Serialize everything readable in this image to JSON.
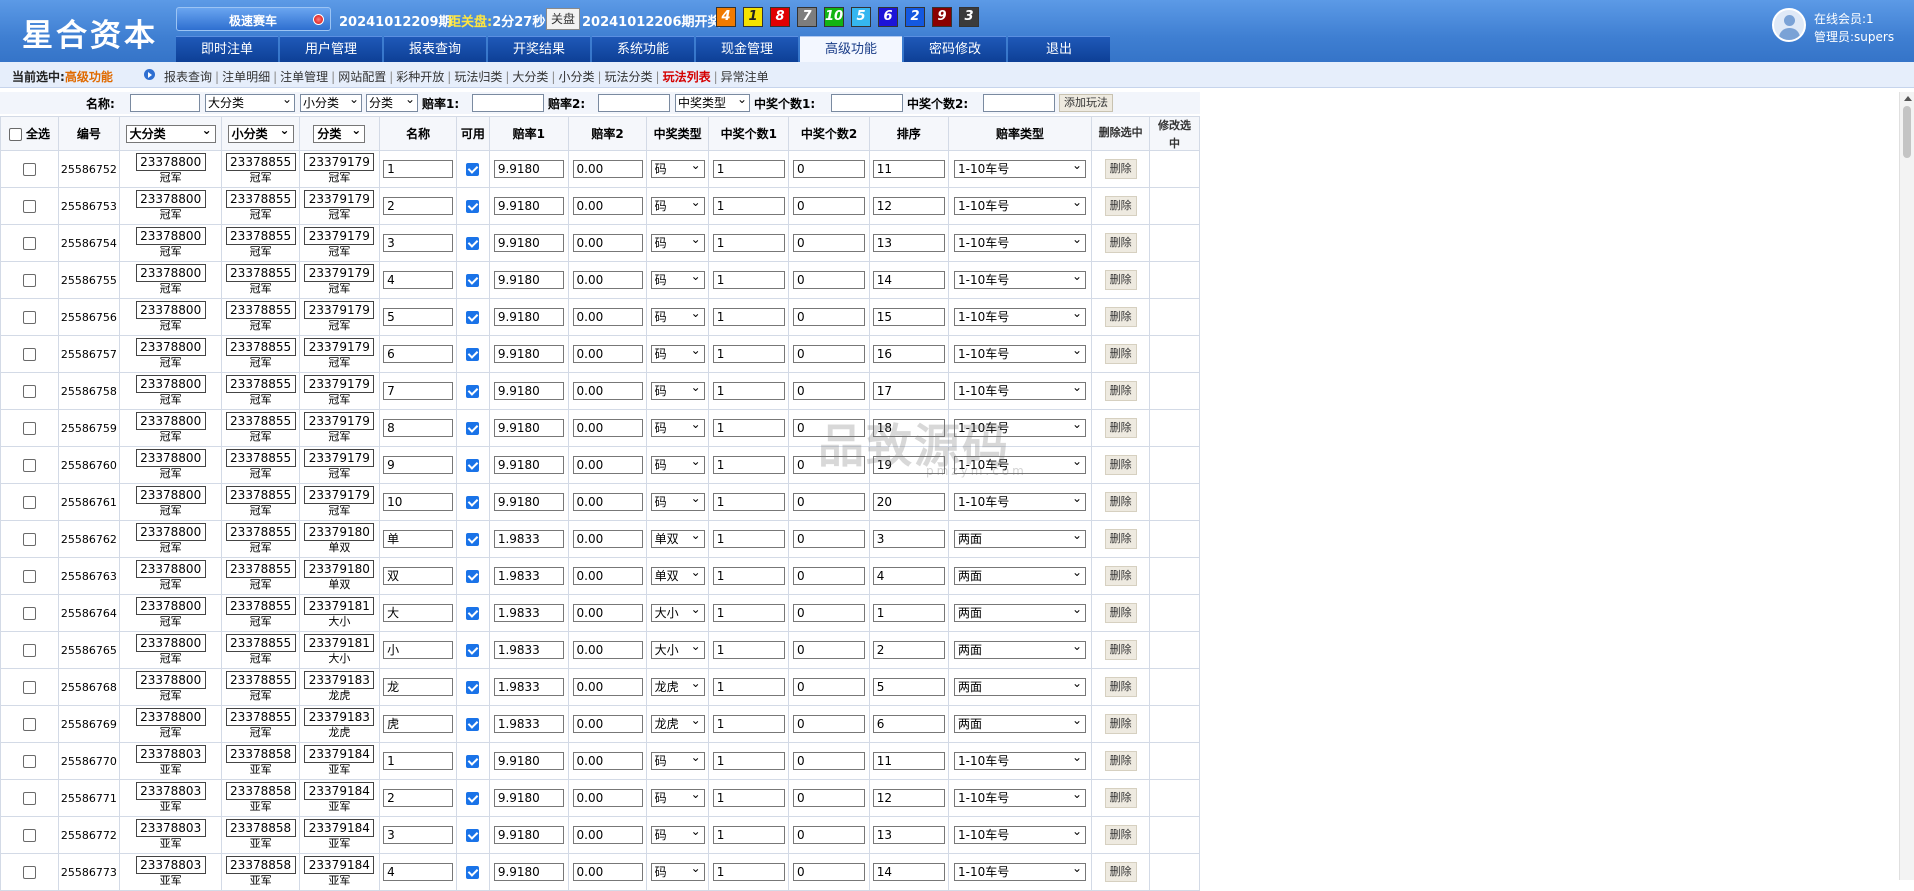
{
  "app": {
    "logo": "星合资本",
    "game_tab": "极速赛车",
    "current_issue": "20241012209期",
    "countdown_label": "距关盘:",
    "countdown": "2分27秒",
    "close_label": "关盘",
    "last_issue": "20241012206期开奖:",
    "draw_numbers": [
      "4",
      "1",
      "8",
      "7",
      "10",
      "5",
      "6",
      "2",
      "9",
      "3"
    ],
    "ball_colors": [
      "#f07a00",
      "#f5e200",
      "#e00000",
      "#7d7d7d",
      "#12b412",
      "#35b6f0",
      "#1c14d8",
      "#1458e0",
      "#8a0000",
      "#3b3b3b"
    ],
    "online_label": "在线会员:",
    "online_count": "1",
    "admin_label": "管理员:",
    "admin_name": "supers"
  },
  "nav": [
    "即时注单",
    "用户管理",
    "报表查询",
    "开奖结果",
    "系统功能",
    "现金管理",
    "高级功能",
    "密码修改",
    "退出"
  ],
  "breadcrumb": {
    "label": "当前选中:",
    "value": "高级功能",
    "submenu": [
      "报表查询",
      "注单明细",
      "注单管理",
      "网站配置",
      "彩种开放",
      "玩法归类",
      "大分类",
      "小分类",
      "玩法分类",
      "玩法列表",
      "异常注单"
    ],
    "active": "玩法列表"
  },
  "filter": {
    "name_label": "名称:",
    "big_cat": "大分类",
    "small_cat": "小分类",
    "cat": "分类",
    "rate1_label": "赔率1:",
    "rate2_label": "赔率2:",
    "win_type": "中奖类型",
    "win1_label": "中奖个数1:",
    "win2_label": "中奖个数2:",
    "add_button": "添加玩法"
  },
  "table": {
    "select_all": "全选",
    "headers": {
      "id": "编号",
      "big": "大分类",
      "small": "小分类",
      "cat": "分类",
      "name": "名称",
      "enabled": "可用",
      "rate1": "赔率1",
      "rate2": "赔率2",
      "win_type": "中奖类型",
      "win1": "中奖个数1",
      "win2": "中奖个数2",
      "order": "排序",
      "rate_type": "赔率类型",
      "delete_selected": "删除选中",
      "edit_selected": "修改选中"
    },
    "delete_label": "删除",
    "rows": [
      {
        "id": "25586752",
        "big": "23378800",
        "big_sub": "冠军",
        "small": "23378855",
        "small_sub": "冠军",
        "cat": "23379179",
        "cat_sub": "冠军",
        "name": "1",
        "rate1": "9.9180",
        "rate2": "0.00",
        "win_type": "码",
        "win1": "1",
        "win2": "0",
        "order": "11",
        "rate_type": "1-10车号"
      },
      {
        "id": "25586753",
        "big": "23378800",
        "big_sub": "冠军",
        "small": "23378855",
        "small_sub": "冠军",
        "cat": "23379179",
        "cat_sub": "冠军",
        "name": "2",
        "rate1": "9.9180",
        "rate2": "0.00",
        "win_type": "码",
        "win1": "1",
        "win2": "0",
        "order": "12",
        "rate_type": "1-10车号"
      },
      {
        "id": "25586754",
        "big": "23378800",
        "big_sub": "冠军",
        "small": "23378855",
        "small_sub": "冠军",
        "cat": "23379179",
        "cat_sub": "冠军",
        "name": "3",
        "rate1": "9.9180",
        "rate2": "0.00",
        "win_type": "码",
        "win1": "1",
        "win2": "0",
        "order": "13",
        "rate_type": "1-10车号"
      },
      {
        "id": "25586755",
        "big": "23378800",
        "big_sub": "冠军",
        "small": "23378855",
        "small_sub": "冠军",
        "cat": "23379179",
        "cat_sub": "冠军",
        "name": "4",
        "rate1": "9.9180",
        "rate2": "0.00",
        "win_type": "码",
        "win1": "1",
        "win2": "0",
        "order": "14",
        "rate_type": "1-10车号"
      },
      {
        "id": "25586756",
        "big": "23378800",
        "big_sub": "冠军",
        "small": "23378855",
        "small_sub": "冠军",
        "cat": "23379179",
        "cat_sub": "冠军",
        "name": "5",
        "rate1": "9.9180",
        "rate2": "0.00",
        "win_type": "码",
        "win1": "1",
        "win2": "0",
        "order": "15",
        "rate_type": "1-10车号"
      },
      {
        "id": "25586757",
        "big": "23378800",
        "big_sub": "冠军",
        "small": "23378855",
        "small_sub": "冠军",
        "cat": "23379179",
        "cat_sub": "冠军",
        "name": "6",
        "rate1": "9.9180",
        "rate2": "0.00",
        "win_type": "码",
        "win1": "1",
        "win2": "0",
        "order": "16",
        "rate_type": "1-10车号"
      },
      {
        "id": "25586758",
        "big": "23378800",
        "big_sub": "冠军",
        "small": "23378855",
        "small_sub": "冠军",
        "cat": "23379179",
        "cat_sub": "冠军",
        "name": "7",
        "rate1": "9.9180",
        "rate2": "0.00",
        "win_type": "码",
        "win1": "1",
        "win2": "0",
        "order": "17",
        "rate_type": "1-10车号"
      },
      {
        "id": "25586759",
        "big": "23378800",
        "big_sub": "冠军",
        "small": "23378855",
        "small_sub": "冠军",
        "cat": "23379179",
        "cat_sub": "冠军",
        "name": "8",
        "rate1": "9.9180",
        "rate2": "0.00",
        "win_type": "码",
        "win1": "1",
        "win2": "0",
        "order": "18",
        "rate_type": "1-10车号"
      },
      {
        "id": "25586760",
        "big": "23378800",
        "big_sub": "冠军",
        "small": "23378855",
        "small_sub": "冠军",
        "cat": "23379179",
        "cat_sub": "冠军",
        "name": "9",
        "rate1": "9.9180",
        "rate2": "0.00",
        "win_type": "码",
        "win1": "1",
        "win2": "0",
        "order": "19",
        "rate_type": "1-10车号"
      },
      {
        "id": "25586761",
        "big": "23378800",
        "big_sub": "冠军",
        "small": "23378855",
        "small_sub": "冠军",
        "cat": "23379179",
        "cat_sub": "冠军",
        "name": "10",
        "rate1": "9.9180",
        "rate2": "0.00",
        "win_type": "码",
        "win1": "1",
        "win2": "0",
        "order": "20",
        "rate_type": "1-10车号"
      },
      {
        "id": "25586762",
        "big": "23378800",
        "big_sub": "冠军",
        "small": "23378855",
        "small_sub": "冠军",
        "cat": "23379180",
        "cat_sub": "单双",
        "name": "单",
        "rate1": "1.9833",
        "rate2": "0.00",
        "win_type": "单双",
        "win1": "1",
        "win2": "0",
        "order": "3",
        "rate_type": "两面"
      },
      {
        "id": "25586763",
        "big": "23378800",
        "big_sub": "冠军",
        "small": "23378855",
        "small_sub": "冠军",
        "cat": "23379180",
        "cat_sub": "单双",
        "name": "双",
        "rate1": "1.9833",
        "rate2": "0.00",
        "win_type": "单双",
        "win1": "1",
        "win2": "0",
        "order": "4",
        "rate_type": "两面"
      },
      {
        "id": "25586764",
        "big": "23378800",
        "big_sub": "冠军",
        "small": "23378855",
        "small_sub": "冠军",
        "cat": "23379181",
        "cat_sub": "大小",
        "name": "大",
        "rate1": "1.9833",
        "rate2": "0.00",
        "win_type": "大小",
        "win1": "1",
        "win2": "0",
        "order": "1",
        "rate_type": "两面"
      },
      {
        "id": "25586765",
        "big": "23378800",
        "big_sub": "冠军",
        "small": "23378855",
        "small_sub": "冠军",
        "cat": "23379181",
        "cat_sub": "大小",
        "name": "小",
        "rate1": "1.9833",
        "rate2": "0.00",
        "win_type": "大小",
        "win1": "1",
        "win2": "0",
        "order": "2",
        "rate_type": "两面"
      },
      {
        "id": "25586768",
        "big": "23378800",
        "big_sub": "冠军",
        "small": "23378855",
        "small_sub": "冠军",
        "cat": "23379183",
        "cat_sub": "龙虎",
        "name": "龙",
        "rate1": "1.9833",
        "rate2": "0.00",
        "win_type": "龙虎",
        "win1": "1",
        "win2": "0",
        "order": "5",
        "rate_type": "两面"
      },
      {
        "id": "25586769",
        "big": "23378800",
        "big_sub": "冠军",
        "small": "23378855",
        "small_sub": "冠军",
        "cat": "23379183",
        "cat_sub": "龙虎",
        "name": "虎",
        "rate1": "1.9833",
        "rate2": "0.00",
        "win_type": "龙虎",
        "win1": "1",
        "win2": "0",
        "order": "6",
        "rate_type": "两面"
      },
      {
        "id": "25586770",
        "big": "23378803",
        "big_sub": "亚军",
        "small": "23378858",
        "small_sub": "亚军",
        "cat": "23379184",
        "cat_sub": "亚军",
        "name": "1",
        "rate1": "9.9180",
        "rate2": "0.00",
        "win_type": "码",
        "win1": "1",
        "win2": "0",
        "order": "11",
        "rate_type": "1-10车号"
      },
      {
        "id": "25586771",
        "big": "23378803",
        "big_sub": "亚军",
        "small": "23378858",
        "small_sub": "亚军",
        "cat": "23379184",
        "cat_sub": "亚军",
        "name": "2",
        "rate1": "9.9180",
        "rate2": "0.00",
        "win_type": "码",
        "win1": "1",
        "win2": "0",
        "order": "12",
        "rate_type": "1-10车号"
      },
      {
        "id": "25586772",
        "big": "23378803",
        "big_sub": "亚军",
        "small": "23378858",
        "small_sub": "亚军",
        "cat": "23379184",
        "cat_sub": "亚军",
        "name": "3",
        "rate1": "9.9180",
        "rate2": "0.00",
        "win_type": "码",
        "win1": "1",
        "win2": "0",
        "order": "13",
        "rate_type": "1-10车号"
      },
      {
        "id": "25586773",
        "big": "23378803",
        "big_sub": "亚军",
        "small": "23378858",
        "small_sub": "亚军",
        "cat": "23379184",
        "cat_sub": "亚军",
        "name": "4",
        "rate1": "9.9180",
        "rate2": "0.00",
        "win_type": "码",
        "win1": "1",
        "win2": "0",
        "order": "14",
        "rate_type": "1-10车号"
      }
    ]
  },
  "watermark": {
    "main": "品致源码",
    "sub": "pmzym.com"
  }
}
